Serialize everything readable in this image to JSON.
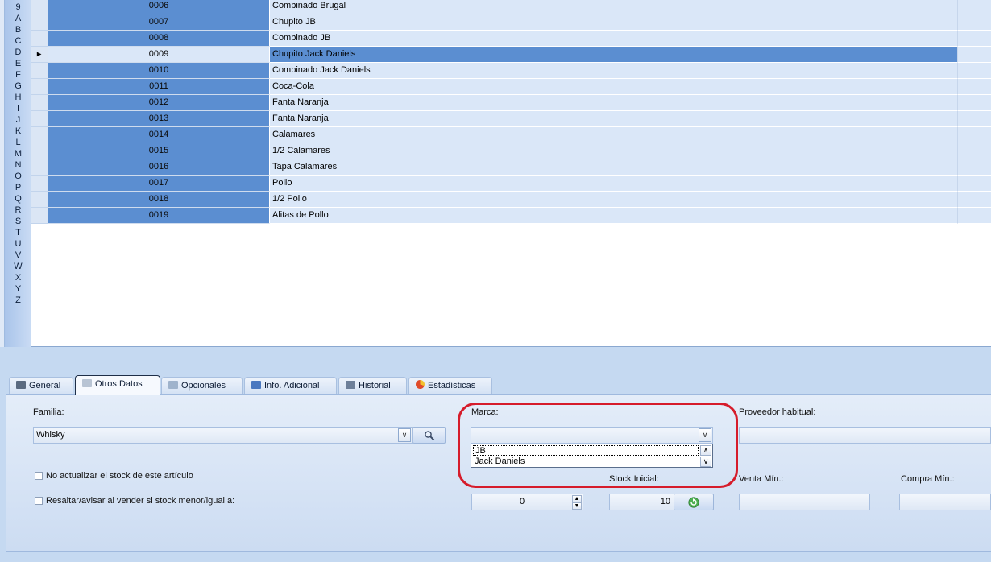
{
  "alphabet": [
    "9",
    "A",
    "B",
    "C",
    "D",
    "E",
    "F",
    "G",
    "H",
    "I",
    "J",
    "K",
    "L",
    "M",
    "N",
    "O",
    "P",
    "Q",
    "R",
    "S",
    "T",
    "U",
    "V",
    "W",
    "X",
    "Y",
    "Z"
  ],
  "rows": [
    {
      "code": "0006",
      "name": "Combinado Brugal"
    },
    {
      "code": "0007",
      "name": "Chupito JB"
    },
    {
      "code": "0008",
      "name": "Combinado JB"
    },
    {
      "code": "0009",
      "name": "Chupito Jack Daniels"
    },
    {
      "code": "0010",
      "name": "Combinado Jack Daniels"
    },
    {
      "code": "0011",
      "name": "Coca-Cola"
    },
    {
      "code": "0012",
      "name": "Fanta Naranja"
    },
    {
      "code": "0013",
      "name": "Fanta Naranja"
    },
    {
      "code": "0014",
      "name": "Calamares"
    },
    {
      "code": "0015",
      "name": "1/2 Calamares"
    },
    {
      "code": "0016",
      "name": "Tapa Calamares"
    },
    {
      "code": "0017",
      "name": "Pollo"
    },
    {
      "code": "0018",
      "name": "1/2 Pollo"
    },
    {
      "code": "0019",
      "name": "Alitas de Pollo"
    }
  ],
  "selected_row_index": 3,
  "tabs": [
    {
      "label": "General",
      "icon": "general-icon"
    },
    {
      "label": "Otros Datos",
      "icon": "document-icon",
      "active": true
    },
    {
      "label": "Opcionales",
      "icon": "list-icon"
    },
    {
      "label": "Info. Adicional",
      "icon": "info-icon"
    },
    {
      "label": "Historial",
      "icon": "history-icon"
    },
    {
      "label": "Estadísticas",
      "icon": "pie-chart-icon"
    }
  ],
  "form": {
    "familia_label": "Familia:",
    "familia_value": "Whisky",
    "marca_label": "Marca:",
    "marca_value": "",
    "marca_options": [
      "JB",
      "Jack Daniels"
    ],
    "proveedor_label": "Proveedor habitual:",
    "no_actualizar_label": "No actualizar el stock de este artículo",
    "resaltar_label": "Resaltar/avisar al vender si stock menor/igual a:",
    "resaltar_value": "0",
    "stock_inicial_label": "Stock Inicial:",
    "stock_inicial_value": "10",
    "venta_min_label": "Venta Mín.:",
    "compra_min_label": "Compra Mín.:"
  },
  "highlight_color": "#d61c2b",
  "accent_color": "#5b8ed1"
}
